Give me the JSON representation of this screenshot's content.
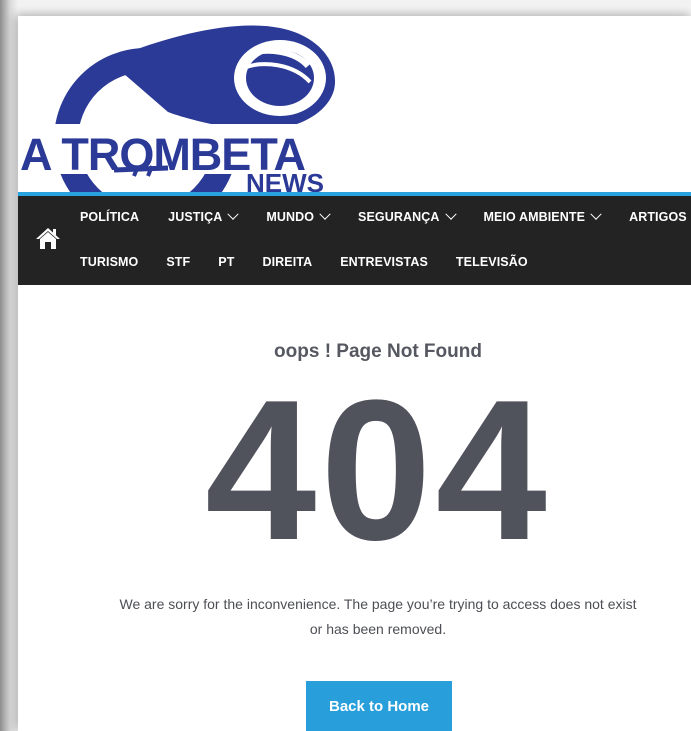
{
  "brand": {
    "logo_line1": "A TROMBETA",
    "logo_line2": "NEWS"
  },
  "colors": {
    "logo_blue": "#2b3a97",
    "accent": "#29a3e0",
    "nav_bg": "#232323",
    "heading": "#50525c"
  },
  "nav": {
    "home_icon": "home-icon",
    "row1": [
      {
        "label": "POLÍTICA",
        "dropdown": false
      },
      {
        "label": "JUSTIÇA",
        "dropdown": true
      },
      {
        "label": "MUNDO",
        "dropdown": true
      },
      {
        "label": "SEGURANÇA",
        "dropdown": true
      },
      {
        "label": "MEIO AMBIENTE",
        "dropdown": true
      },
      {
        "label": "ARTIGOS",
        "dropdown": false
      }
    ],
    "row2": [
      {
        "label": "TURISMO"
      },
      {
        "label": "STF"
      },
      {
        "label": "PT"
      },
      {
        "label": "DIREITA"
      },
      {
        "label": "ENTREVISTAS"
      },
      {
        "label": "TELEVISÃO"
      }
    ]
  },
  "error": {
    "title": "oops ! Page Not Found",
    "code": "404",
    "message": "We are sorry for the inconvenience. The page you’re trying to access does not exist or has been removed.",
    "button_label": "Back to Home"
  }
}
